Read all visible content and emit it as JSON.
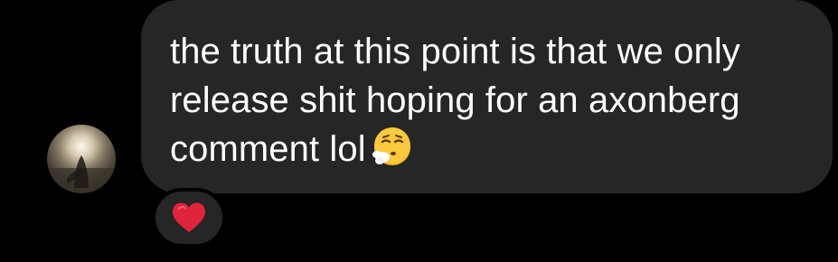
{
  "message": {
    "text": "the truth at this point is that we only release shit hoping for an axonberg comment lol",
    "emoji": "face-exhaling-emoji"
  },
  "reaction": {
    "icon": "red-heart-icon",
    "color": "#e0243b"
  },
  "colors": {
    "background": "#000000",
    "bubble": "#262626",
    "text": "#ffffff"
  }
}
